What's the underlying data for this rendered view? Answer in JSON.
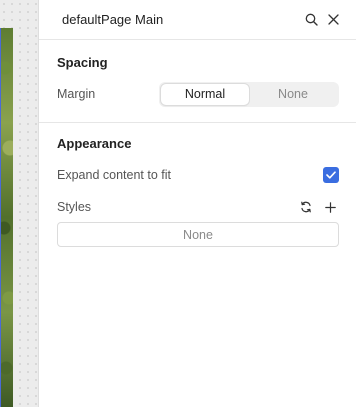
{
  "panel": {
    "title": "defaultPage Main"
  },
  "spacing": {
    "heading": "Spacing",
    "margin_label": "Margin",
    "options": [
      "Normal",
      "None"
    ],
    "selected": "Normal"
  },
  "appearance": {
    "heading": "Appearance",
    "expand_label": "Expand content to fit",
    "expand_checked": true,
    "styles_label": "Styles",
    "styles_value": "None"
  },
  "colors": {
    "accent": "#3a6de0",
    "panel_bg": "#ffffff",
    "canvas_bg": "#ececec"
  },
  "icons": {
    "search": "search-icon",
    "close": "close-icon",
    "refresh": "refresh-icon",
    "add": "plus-icon",
    "check": "check-icon"
  }
}
